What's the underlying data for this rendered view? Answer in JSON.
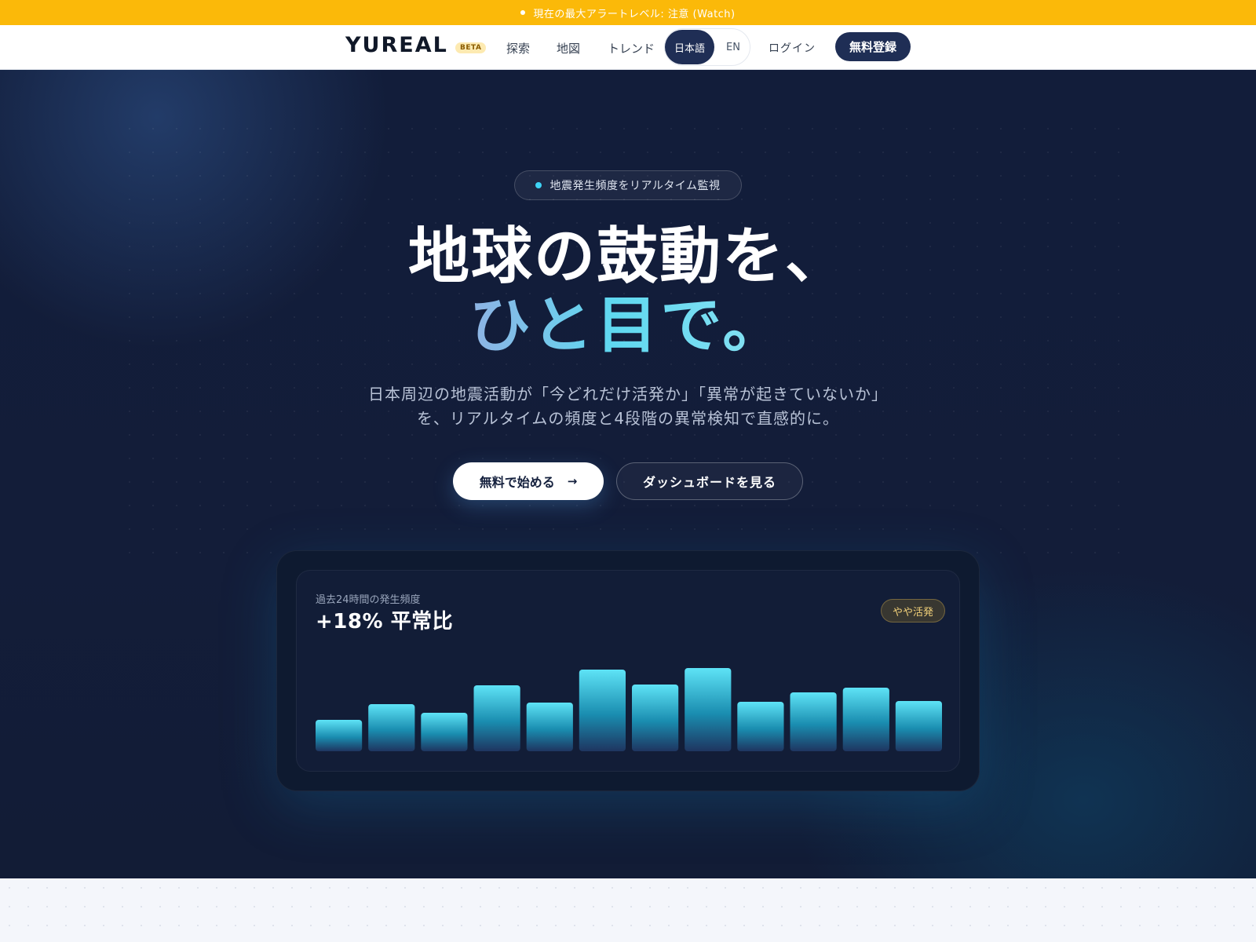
{
  "alert": {
    "text": "現在の最大アラートレベル: 注意 (Watch)"
  },
  "header": {
    "logo": "YUREAL",
    "beta": "BETA",
    "nav": [
      "探索",
      "地図",
      "トレンド"
    ],
    "lang": {
      "ja": "日本語",
      "en": "EN",
      "active": "ja"
    },
    "login": "ログイン",
    "signup": "無料登録"
  },
  "hero": {
    "pill": "地震発生頻度をリアルタイム監視",
    "headline_line1": "地球の鼓動を、",
    "headline_line2": "ひと目で。",
    "lead": "日本周辺の地震活動が「今どれだけ活発か」「異常が起きていないか」を、リアルタイムの頻度と4段階の異常検知で直感的に。",
    "cta_primary": "無料で始める",
    "cta_arrow": "→",
    "cta_secondary": "ダッシュボードを見る"
  },
  "card": {
    "label": "過去24時間の発生頻度",
    "value": "+18% 平常比",
    "status": "やや活発"
  },
  "colors": {
    "alert": "#fbb909",
    "brand_navy": "#1f2e55",
    "bar_top": "#5ee3f6",
    "bar_bottom": "#1e3560"
  },
  "chart_data": {
    "type": "bar",
    "title": "",
    "xlabel": "",
    "ylabel": "",
    "categories": [],
    "values": [
      40,
      60,
      49,
      84,
      62,
      104,
      85,
      106,
      63,
      75,
      81,
      64
    ],
    "ylim": [
      0,
      130
    ],
    "grid": false
  }
}
